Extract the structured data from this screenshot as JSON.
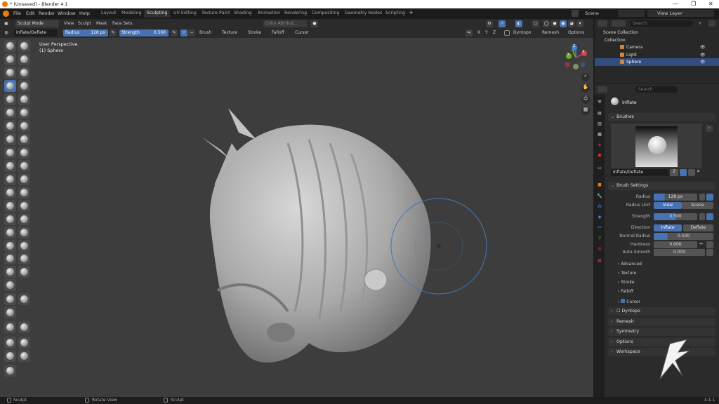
{
  "window": {
    "title": "* (Unsaved) - Blender 4.1",
    "min": "—",
    "max": "❐",
    "close": "✕"
  },
  "menu": {
    "file": "File",
    "edit": "Edit",
    "render": "Render",
    "window": "Window",
    "help": "Help"
  },
  "workspaces": [
    "Layout",
    "Modeling",
    "Sculpting",
    "UV Editing",
    "Texture Paint",
    "Shading",
    "Animation",
    "Rendering",
    "Compositing",
    "Geometry Nodes",
    "Scripting"
  ],
  "workspace_add": "+",
  "scene": {
    "label": "Scene",
    "viewlayer": "View Layer"
  },
  "header": {
    "mode": "Sculpt Mode",
    "view": "View",
    "sculpt": "Sculpt",
    "mask": "Mask",
    "face_sets": "Face Sets",
    "color_attr": "Color Attribut...",
    "x": "X",
    "y": "Y",
    "z": "Z",
    "dyntopo": "Dyntopo",
    "remesh": "Remesh",
    "options": "Options"
  },
  "toolsettings": {
    "brush": "Inflate/Deflate",
    "radius_label": "Radius",
    "radius": "128 px",
    "strength_label": "Strength",
    "strength": "0.500",
    "plus": "+",
    "minus": "−",
    "brush_dd": "Brush",
    "texture_dd": "Texture",
    "stroke_dd": "Stroke",
    "falloff_dd": "Falloff",
    "cursor_dd": "Cursor"
  },
  "viewport": {
    "perspective": "User Perspective",
    "object": "(1) Sphere",
    "gizmo_x": "X",
    "gizmo_y": "Y",
    "gizmo_z": "Z"
  },
  "outliner": {
    "search": "Search",
    "items": [
      {
        "label": "Scene Collection"
      },
      {
        "label": "Collection"
      },
      {
        "label": "Camera"
      },
      {
        "label": "Light"
      },
      {
        "label": "Sphere"
      }
    ]
  },
  "properties": {
    "search": "Search",
    "tool_name": "Inflate",
    "brushes_panel": "Brushes",
    "brush_name": "Inflate/Deflate",
    "brush_users": "2",
    "brush_settings": "Brush Settings",
    "radius_label": "Radius",
    "radius": "128 px",
    "radius_unit_label": "Radius Unit",
    "unit_view": "View",
    "unit_scene": "Scene",
    "strength_label": "Strength",
    "strength": "0.500",
    "direction_label": "Direction",
    "dir_inflate": "Inflate",
    "dir_deflate": "Deflate",
    "normal_radius_label": "Normal Radius",
    "normal_radius": "0.500",
    "hardness_label": "Hardness",
    "hardness": "0.000",
    "autosmooth_label": "Auto-Smooth",
    "autosmooth": "0.000",
    "subpanels": [
      "Advanced",
      "Texture",
      "Stroke",
      "Falloff",
      "Cursor"
    ],
    "panels": [
      "Dyntopo",
      "Remesh",
      "Symmetry",
      "Options",
      "Workspace"
    ]
  },
  "status": {
    "left": "Sculpt",
    "mid": "Rotate View",
    "right": "Sculpt",
    "version": "4.1.1"
  },
  "colors": {
    "accent": "#4772b3",
    "brand": "#e87d0d"
  }
}
